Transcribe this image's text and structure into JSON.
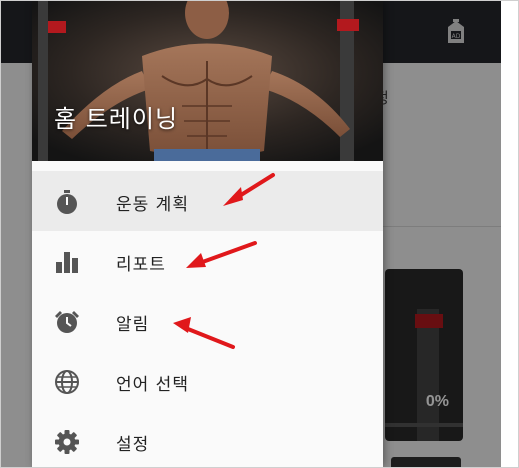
{
  "drawer": {
    "title": "홈 트레이닝",
    "items": [
      {
        "label": "운동 계획",
        "icon": "stopwatch-icon"
      },
      {
        "label": "리포트",
        "icon": "bar-chart-icon"
      },
      {
        "label": "알림",
        "icon": "alarm-clock-icon"
      },
      {
        "label": "언어 선택",
        "icon": "globe-icon"
      },
      {
        "label": "설정",
        "icon": "gear-icon"
      }
    ],
    "active_index": 0
  },
  "background_screen": {
    "partial_label": "정",
    "card_percent": "0%"
  },
  "colors": {
    "annotation_red": "#e0181b",
    "icon_gray": "#555555",
    "topbar": "#25262b"
  }
}
